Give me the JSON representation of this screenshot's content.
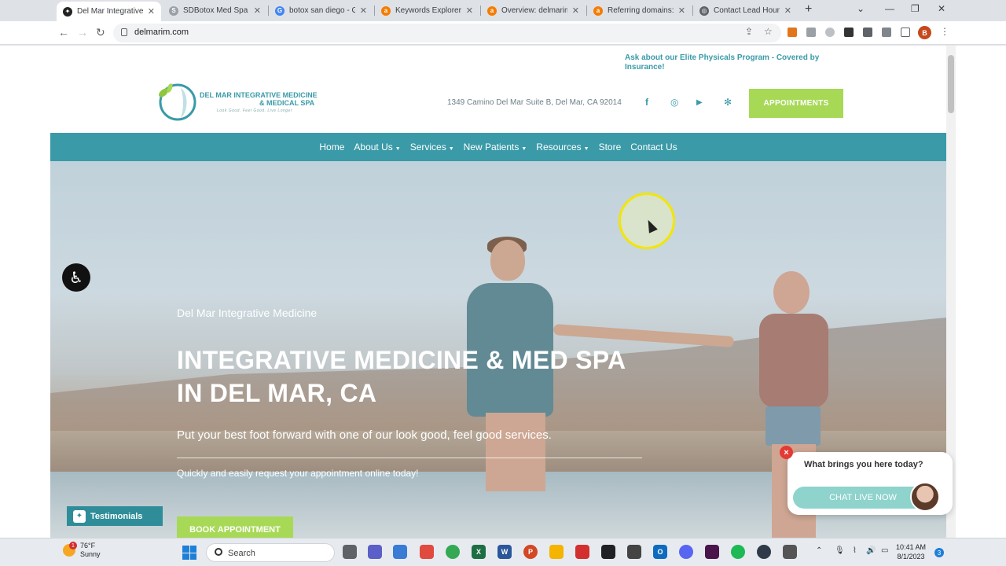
{
  "browser": {
    "tabs": [
      {
        "title": "Del Mar Integrative M",
        "color": "#222222",
        "glyph": "✦",
        "active": true
      },
      {
        "title": "SDBotox Med Spa for",
        "color": "#9aa0a6",
        "glyph": "S"
      },
      {
        "title": "botox san diego - Goo",
        "color": "#4285f4",
        "glyph": "G"
      },
      {
        "title": "Keywords Explorer - A",
        "color": "#f57c00",
        "glyph": "a"
      },
      {
        "title": "Overview: delmarim.c",
        "color": "#f57c00",
        "glyph": "a"
      },
      {
        "title": "Referring domains: sd",
        "color": "#f57c00",
        "glyph": "a"
      },
      {
        "title": "Contact Lead Hounds",
        "color": "#5f6368",
        "glyph": "◎"
      }
    ],
    "url": "delmarim.com",
    "profile_initial": "B"
  },
  "site": {
    "promo": "Ask about our Elite Physicals Program - Covered by Insurance!",
    "logo": {
      "line1": "DEL MAR INTEGRATIVE MEDICINE",
      "line2": "& MEDICAL SPA",
      "tagline": "Look Good. Feel Good. Live Longer"
    },
    "address": "1349 Camino Del Mar Suite B, Del Mar, CA 92014",
    "social": {
      "facebook": "f",
      "instagram": "◎",
      "youtube": "▶",
      "yelp": "✻"
    },
    "appointments_label": "APPOINTMENTS",
    "nav": [
      {
        "label": "Home",
        "caret": ""
      },
      {
        "label": "About Us",
        "caret": "▼"
      },
      {
        "label": "Services",
        "caret": "▼"
      },
      {
        "label": "New Patients",
        "caret": "▼"
      },
      {
        "label": "Resources",
        "caret": "▼"
      },
      {
        "label": "Store",
        "caret": ""
      },
      {
        "label": "Contact Us",
        "caret": ""
      }
    ],
    "hero": {
      "kicker": "Del Mar Integrative Medicine",
      "title_line1": "INTEGRATIVE MEDICINE & MED SPA",
      "title_line2": "IN DEL MAR, CA",
      "subtitle": "Put your best foot forward with one of our look good, feel good services.",
      "note": "Quickly and easily request your appointment online today!",
      "book_label": "BOOK APPOINTMENT"
    },
    "testimonials_label": "Testimonials",
    "chat": {
      "question": "What brings you here today?",
      "button": "CHAT LIVE NOW",
      "close": "×"
    }
  },
  "taskbar": {
    "weather_temp": "76°F",
    "weather_desc": "Sunny",
    "weather_badge": "1",
    "search_label": "Search",
    "time": "10:41 AM",
    "date": "8/1/2023",
    "notifications": "3"
  }
}
